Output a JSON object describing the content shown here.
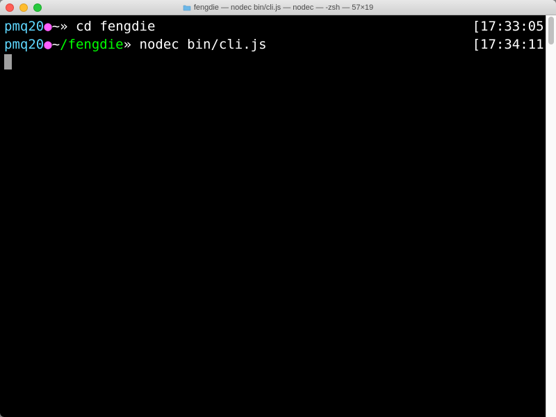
{
  "window": {
    "title": "fengdie — nodec bin/cli.js — nodec — -zsh — 57×19"
  },
  "lines": [
    {
      "user": "pmq20",
      "dot": "●",
      "tilde": "~",
      "path": "",
      "chevron": "» ",
      "command": "cd fengdie",
      "timestamp": "[17:33:05]"
    },
    {
      "user": "pmq20",
      "dot": "●",
      "tilde": "~",
      "path": "/fengdie",
      "chevron": "» ",
      "command": "nodec bin/cli.js",
      "timestamp": "[17:34:11]"
    }
  ]
}
